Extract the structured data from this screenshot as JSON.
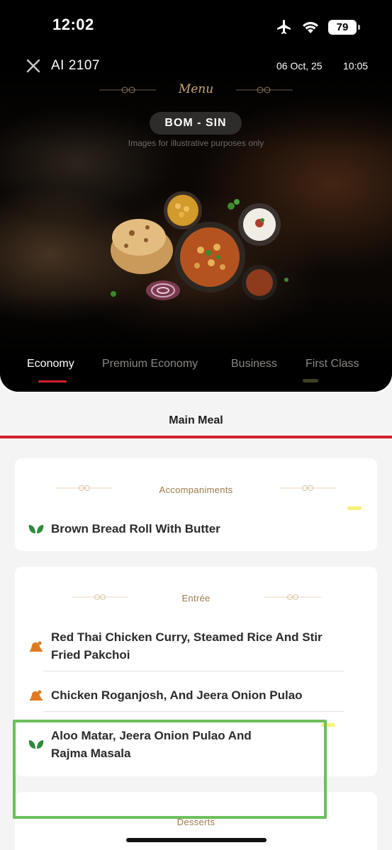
{
  "status_bar": {
    "time": "12:02",
    "battery": "79"
  },
  "flight": {
    "number": "AI 2107",
    "date": "06 Oct, 25",
    "time": "10:05"
  },
  "menu_title": "Menu",
  "route": "BOM - SIN",
  "disclaimer": "Images for illustrative purposes only",
  "cabin_tabs": [
    {
      "label": "Economy",
      "active": true
    },
    {
      "label": "Premium Economy",
      "active": false
    },
    {
      "label": "Business",
      "active": false
    },
    {
      "label": "First Class",
      "active": false
    }
  ],
  "meal_tab": "Main Meal",
  "sections": [
    {
      "title": "Accompaniments",
      "items": [
        {
          "name": "Brown Bread Roll With Butter",
          "icon": "veg-leaf-icon"
        }
      ]
    },
    {
      "title": "Entrée",
      "items": [
        {
          "name": "Red Thai Chicken Curry, Steamed Rice And Stir Fried Pakchoi",
          "icon": "non-veg-chicken-icon"
        },
        {
          "name": "Chicken Roganjosh, And Jeera Onion Pulao",
          "icon": "non-veg-chicken-icon"
        },
        {
          "name": "Aloo Matar, Jeera Onion Pulao And Rajma Masala",
          "icon": "veg-leaf-icon"
        }
      ]
    },
    {
      "title": "Desserts",
      "items": []
    }
  ],
  "colors": {
    "accent_red": "#d4202a",
    "gold_text": "#9c7a4c",
    "veg_green": "#2e8b3a",
    "non_veg_orange": "#e07a1f",
    "highlight_box": "#6cc05c"
  }
}
